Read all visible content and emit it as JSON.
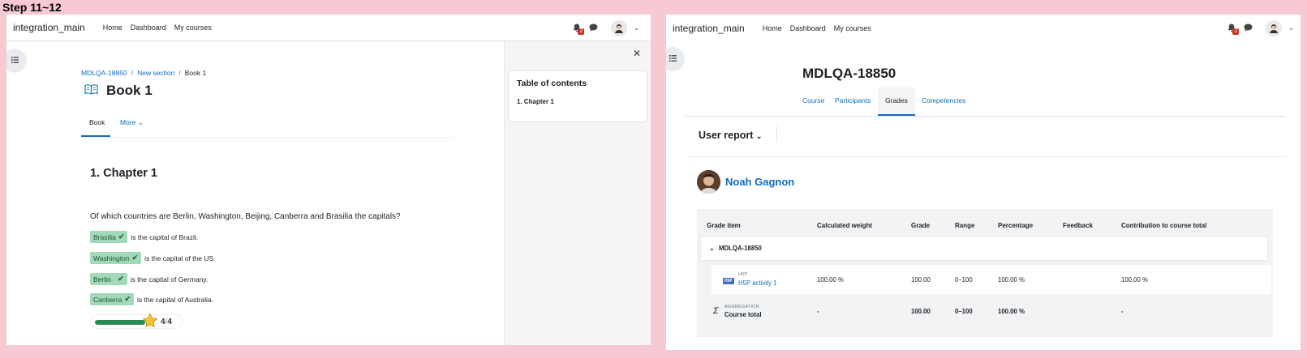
{
  "step_label": "Step 11~12",
  "left": {
    "navbar": {
      "brand": "integration_main",
      "links": [
        "Home",
        "Dashboard",
        "My courses"
      ],
      "notification_count": "2"
    },
    "breadcrumb": [
      "MDLQA-18850",
      "New section",
      "Book 1"
    ],
    "page_title": "Book 1",
    "tabs": [
      "Book",
      "More"
    ],
    "chapter_title": "1. Chapter 1",
    "question": "Of which countries are Berlin, Washington, Beijing, Canberra and Brasilia the capitals?",
    "drop_rows": [
      {
        "answer": "Brasilia",
        "text": "is the capital of Brazil."
      },
      {
        "answer": "Washington",
        "text": "is the capital of the US."
      },
      {
        "answer": "Berlin",
        "text": "is the capital of Germany."
      },
      {
        "answer": "Canberra",
        "text": "is the capital of Australia."
      }
    ],
    "score": {
      "earned": "4",
      "sep": "/",
      "total": "4",
      "fraction": 1.0
    },
    "toc": {
      "title": "Table of contents",
      "items": [
        "1. Chapter 1"
      ]
    }
  },
  "right": {
    "navbar": {
      "brand": "integration_main",
      "links": [
        "Home",
        "Dashboard",
        "My courses"
      ],
      "notification_count": "2"
    },
    "course_title": "MDLQA-18850",
    "tabs": [
      "Course",
      "Participants",
      "Grades",
      "Competencies"
    ],
    "active_tab": "Grades",
    "report_selector": "User report",
    "user_name": "Noah Gagnon",
    "table": {
      "headers": [
        "Grade item",
        "Calculated weight",
        "Grade",
        "Range",
        "Percentage",
        "Feedback",
        "Contribution to course total"
      ],
      "category": "MDLQA-18850",
      "item": {
        "type_label": "H5P",
        "name": "H5P activity 1",
        "weight": "100.00 %",
        "grade": "100.00",
        "range": "0–100",
        "percentage": "100.00 %",
        "feedback": "",
        "contribution": "100.00 %"
      },
      "total": {
        "type_label": "AGGREGATION",
        "name": "Course total",
        "weight": "-",
        "grade": "100.00",
        "range": "0–100",
        "percentage": "100.00 %",
        "feedback": "",
        "contribution": "-"
      }
    }
  },
  "colors": {
    "background": "#f7c9d2",
    "link": "#0f6cbf",
    "correct_pill": "#a3d8b8",
    "score_bar": "#2a8a56",
    "badge": "#ca3120"
  }
}
